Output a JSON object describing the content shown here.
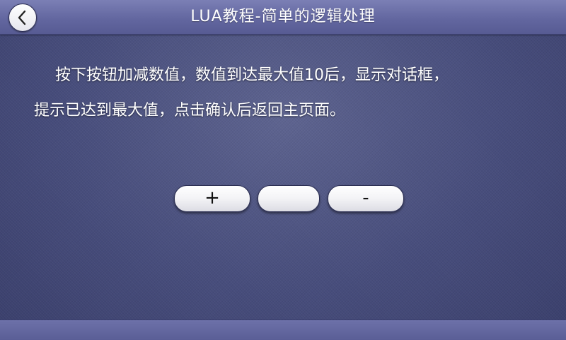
{
  "header": {
    "title": "LUA教程-简单的逻辑处理",
    "back_icon": "chevron-left-icon"
  },
  "description": {
    "line1": "按下按钮加减数值，数值到达最大值10后，显示对话框，",
    "line2": "提示已达到最大值，点击确认后返回主页面。"
  },
  "controls": {
    "plus_label": "+",
    "value_label": "",
    "minus_label": "-"
  },
  "colors": {
    "background": "#474d7c",
    "title_bar": "#6367a0",
    "button_face": "#f3f3f6"
  }
}
